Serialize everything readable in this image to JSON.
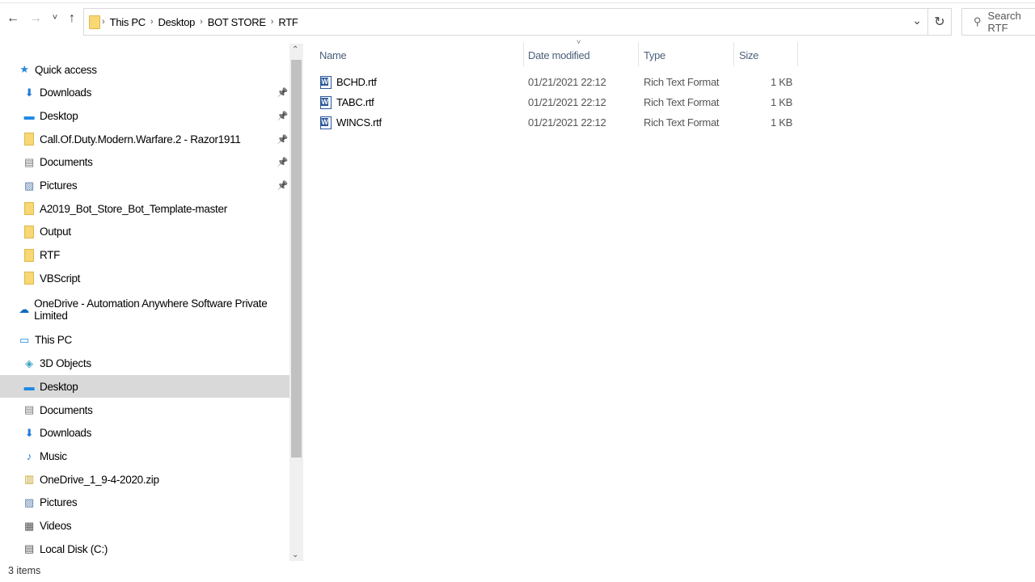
{
  "toolbar": {
    "back": "←",
    "forward": "→",
    "recent": "˅",
    "up": "↑",
    "refresh": "↻",
    "dropdown": "⌄"
  },
  "breadcrumb": [
    "This PC",
    "Desktop",
    "BOT STORE",
    "RTF"
  ],
  "search": {
    "placeholder": "Search RTF"
  },
  "nav": [
    {
      "label": "Quick access",
      "icon": "star-icon",
      "level": 0
    },
    {
      "label": "Downloads",
      "icon": "download-icon",
      "level": 1,
      "pinned": true
    },
    {
      "label": "Desktop",
      "icon": "desktop-icon",
      "level": 1,
      "pinned": true
    },
    {
      "label": "Call.Of.Duty.Modern.Warfare.2 - Razor1911",
      "icon": "folder-icon",
      "level": 1,
      "pinned": true
    },
    {
      "label": "Documents",
      "icon": "documents-icon",
      "level": 1,
      "pinned": true
    },
    {
      "label": "Pictures",
      "icon": "pictures-icon",
      "level": 1,
      "pinned": true
    },
    {
      "label": "A2019_Bot_Store_Bot_Template-master",
      "icon": "folder-icon",
      "level": 1
    },
    {
      "label": "Output",
      "icon": "folder-icon",
      "level": 1
    },
    {
      "label": "RTF",
      "icon": "folder-icon",
      "level": 1
    },
    {
      "label": "VBScript",
      "icon": "folder-icon",
      "level": 1
    },
    {
      "label": "OneDrive - Automation Anywhere Software Private Limited",
      "icon": "cloud-icon",
      "level": 0,
      "gap": true
    },
    {
      "label": "This PC",
      "icon": "computer-icon",
      "level": 0,
      "gap": true
    },
    {
      "label": "3D Objects",
      "icon": "cube-icon",
      "level": 1
    },
    {
      "label": "Desktop",
      "icon": "desktop-icon",
      "level": 1,
      "selected": true
    },
    {
      "label": "Documents",
      "icon": "documents-icon",
      "level": 1
    },
    {
      "label": "Downloads",
      "icon": "download-icon",
      "level": 1
    },
    {
      "label": "Music",
      "icon": "music-icon",
      "level": 1
    },
    {
      "label": "OneDrive_1_9-4-2020.zip",
      "icon": "zip-icon",
      "level": 1
    },
    {
      "label": "Pictures",
      "icon": "pictures-icon",
      "level": 1
    },
    {
      "label": "Videos",
      "icon": "videos-icon",
      "level": 1
    },
    {
      "label": "Local Disk (C:)",
      "icon": "drive-icon",
      "level": 1
    }
  ],
  "columns": {
    "name": "Name",
    "date": "Date modified",
    "type": "Type",
    "size": "Size"
  },
  "files": [
    {
      "name": "BCHD.rtf",
      "date": "01/21/2021 22:12",
      "type": "Rich Text Format",
      "size": "1 KB"
    },
    {
      "name": "TABC.rtf",
      "date": "01/21/2021 22:12",
      "type": "Rich Text Format",
      "size": "1 KB"
    },
    {
      "name": "WINCS.rtf",
      "date": "01/21/2021 22:12",
      "type": "Rich Text Format",
      "size": "1 KB"
    }
  ],
  "status": "3 items"
}
